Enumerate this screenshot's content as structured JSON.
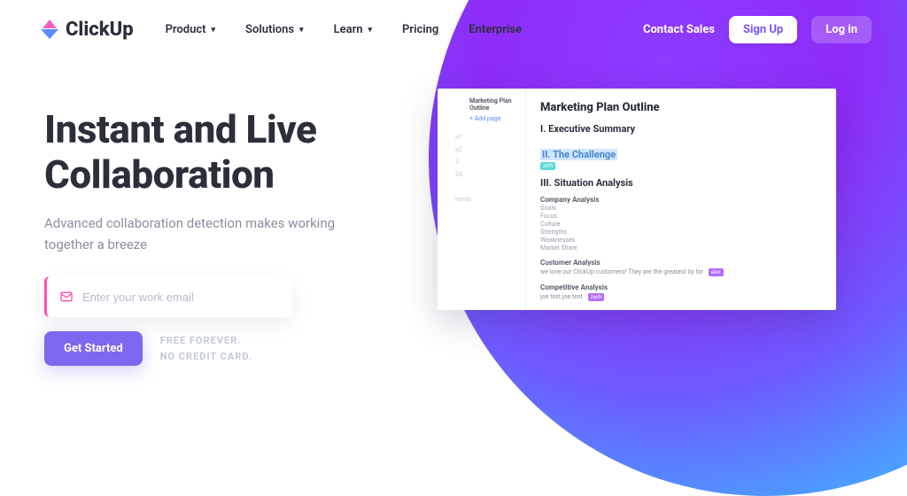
{
  "brand": {
    "name": "ClickUp"
  },
  "nav": {
    "items": [
      {
        "label": "Product",
        "hasChevron": true
      },
      {
        "label": "Solutions",
        "hasChevron": true
      },
      {
        "label": "Learn",
        "hasChevron": true
      },
      {
        "label": "Pricing",
        "hasChevron": false
      },
      {
        "label": "Enterprise",
        "hasChevron": false
      }
    ],
    "contact_sales": "Contact Sales",
    "signup": "Sign Up",
    "login": "Log in"
  },
  "hero": {
    "title_line1": "Instant and Live",
    "title_line2": "Collaboration",
    "subtitle": "Advanced collaboration detection makes working together a breeze",
    "email_placeholder": "Enter your work email",
    "cta": "Get Started",
    "meta_line1": "FREE FOREVER.",
    "meta_line2": "NO CREDIT CARD."
  },
  "doc": {
    "sidebar": {
      "title": "Marketing Plan Outline",
      "add_page": "+ Add page",
      "rows": [
        "a1",
        "a2",
        "3",
        "2d",
        "",
        "nents"
      ]
    },
    "title": "Marketing Plan Outline",
    "sections": [
      {
        "heading": "I. Executive Summary"
      },
      {
        "heading": "II. The Challenge",
        "highlighted": true,
        "tag": "zeth"
      },
      {
        "heading": "III. Situation Analysis"
      }
    ],
    "company_analysis": {
      "label": "Company Analysis",
      "items": [
        "Goals",
        "Focus",
        "Culture",
        "Strengths",
        "Weaknesses",
        "Market Share"
      ]
    },
    "customer_analysis": {
      "label": "Customer Analysis",
      "line": "we love our ClickUp customers! They are the greatest by far",
      "badge": "alex"
    },
    "competitive_analysis": {
      "label": "Competitive Analysis",
      "line": "joe test joe test",
      "badge": "zach"
    }
  }
}
